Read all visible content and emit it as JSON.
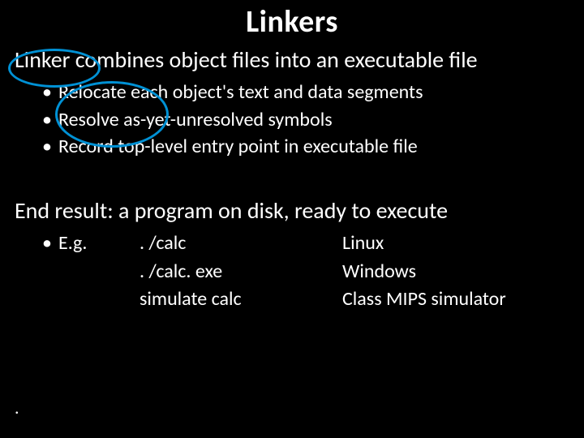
{
  "title": "Linkers",
  "line1": "Linker combines object files into an executable file",
  "bullets": [
    "Relocate each object's text and data segments",
    "Resolve as-yet-unresolved symbols",
    "Record top-level entry point in executable file"
  ],
  "line2": "End result: a program on disk, ready to execute",
  "eg": {
    "label": "E.g.",
    "rows": [
      {
        "cmd": ". /calc",
        "os": "Linux"
      },
      {
        "cmd": ". /calc. exe",
        "os": "Windows"
      },
      {
        "cmd": "simulate calc",
        "os": "Class MIPS simulator"
      }
    ]
  },
  "footer": "."
}
